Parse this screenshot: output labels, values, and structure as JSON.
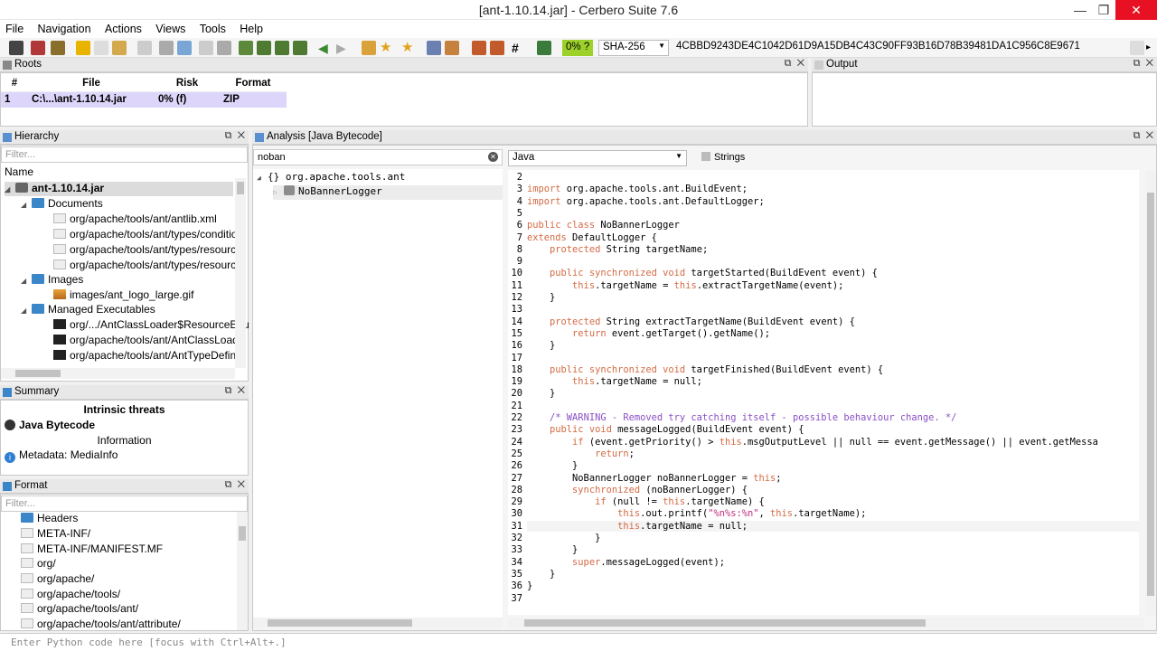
{
  "window": {
    "title": "[ant-1.10.14.jar] - Cerbero Suite 7.6"
  },
  "menu": [
    "File",
    "Navigation",
    "Actions",
    "Views",
    "Tools",
    "Help"
  ],
  "toolbar": {
    "progress": "0% ?",
    "hash_algo": "SHA-256",
    "hash_value": "4CBBD9243DE4C1042D61D9A15DB4C43C90FF93B16D78B39481DA1C956C8E9671"
  },
  "roots": {
    "title": "Roots",
    "columns": [
      "#",
      "File",
      "Risk",
      "Format"
    ],
    "rows": [
      {
        "num": "1",
        "file": "C:\\...\\ant-1.10.14.jar",
        "risk": "0% (f)",
        "format": "ZIP"
      }
    ]
  },
  "output": {
    "title": "Output"
  },
  "hierarchy": {
    "title": "Hierarchy",
    "filter_placeholder": "Filter...",
    "column": "Name",
    "items": [
      "ant-1.10.14.jar",
      "Documents",
      "org/apache/tools/ant/antlib.xml",
      "org/apache/tools/ant/types/conditio",
      "org/apache/tools/ant/types/resourc",
      "org/apache/tools/ant/types/resourc",
      "Images",
      "images/ant_logo_large.gif",
      "Managed Executables",
      "org/.../AntClassLoader$ResourceEnu",
      "org/apache/tools/ant/AntClassLoad",
      "org/apache/tools/ant/AntTypeDefin"
    ]
  },
  "summary": {
    "title": "Summary",
    "header": "Intrinsic threats",
    "threat": "Java Bytecode",
    "info_header": "Information",
    "info": "Metadata: MediaInfo"
  },
  "format": {
    "title": "Format",
    "filter_placeholder": "Filter...",
    "items": [
      "Headers",
      "META-INF/",
      "META-INF/MANIFEST.MF",
      "org/",
      "org/apache/",
      "org/apache/tools/",
      "org/apache/tools/ant/",
      "org/apache/tools/ant/attribute/"
    ]
  },
  "analysis": {
    "title": "Analysis [Java Bytecode]",
    "search_value": "noban",
    "language": "Java",
    "strings_label": "Strings",
    "tree_package": "org.apache.tools.ant",
    "tree_class": "NoBannerLogger",
    "package_glyph": "{}"
  },
  "code_lines": [
    {
      "n": "2",
      "html": ""
    },
    {
      "n": "3",
      "html": "<span class='kw'>import</span> org.apache.tools.ant.BuildEvent;"
    },
    {
      "n": "4",
      "html": "<span class='kw'>import</span> org.apache.tools.ant.DefaultLogger;"
    },
    {
      "n": "5",
      "html": ""
    },
    {
      "n": "6",
      "html": "<span class='kw'>public class</span> NoBannerLogger"
    },
    {
      "n": "7",
      "html": "<span class='kw'>extends</span> DefaultLogger {"
    },
    {
      "n": "8",
      "html": "    <span class='kw'>protected</span> String targetName;"
    },
    {
      "n": "9",
      "html": ""
    },
    {
      "n": "10",
      "html": "    <span class='kw'>public synchronized void</span> targetStarted(BuildEvent event) {"
    },
    {
      "n": "11",
      "html": "        <span class='kw'>this</span>.targetName = <span class='kw'>this</span>.extractTargetName(event);"
    },
    {
      "n": "12",
      "html": "    }"
    },
    {
      "n": "13",
      "html": ""
    },
    {
      "n": "14",
      "html": "    <span class='kw'>protected</span> String extractTargetName(BuildEvent event) {"
    },
    {
      "n": "15",
      "html": "        <span class='kw'>return</span> event.getTarget().getName();"
    },
    {
      "n": "16",
      "html": "    }"
    },
    {
      "n": "17",
      "html": ""
    },
    {
      "n": "18",
      "html": "    <span class='kw'>public synchronized void</span> targetFinished(BuildEvent event) {"
    },
    {
      "n": "19",
      "html": "        <span class='kw'>this</span>.targetName = null;"
    },
    {
      "n": "20",
      "html": "    }"
    },
    {
      "n": "21",
      "html": ""
    },
    {
      "n": "22",
      "html": "    <span class='cm'>/* WARNING - Removed try catching itself - possible behaviour change. */</span>"
    },
    {
      "n": "23",
      "html": "    <span class='kw'>public void</span> messageLogged(BuildEvent event) {"
    },
    {
      "n": "24",
      "html": "        <span class='kw'>if</span> (event.getPriority() &gt; <span class='kw'>this</span>.msgOutputLevel || null == event.getMessage() || event.getMessa"
    },
    {
      "n": "25",
      "html": "            <span class='kw'>return</span>;"
    },
    {
      "n": "26",
      "html": "        }"
    },
    {
      "n": "27",
      "html": "        NoBannerLogger noBannerLogger = <span class='kw'>this</span>;"
    },
    {
      "n": "28",
      "html": "        <span class='kw'>synchronized</span> (noBannerLogger) {"
    },
    {
      "n": "29",
      "html": "            <span class='kw'>if</span> (null != <span class='kw'>this</span>.targetName) {"
    },
    {
      "n": "30",
      "html": "                <span class='kw'>this</span>.out.printf(<span class='st'>\"%n%s:%n\"</span>, <span class='kw'>this</span>.targetName);"
    },
    {
      "n": "31",
      "html": "                <span class='kw'>this</span>.targetName = null;"
    },
    {
      "n": "32",
      "html": "            }"
    },
    {
      "n": "33",
      "html": "        }"
    },
    {
      "n": "34",
      "html": "        <span class='kw'>super</span>.messageLogged(event);"
    },
    {
      "n": "35",
      "html": "    }"
    },
    {
      "n": "36",
      "html": "}"
    },
    {
      "n": "37",
      "html": ""
    }
  ],
  "status": {
    "placeholder": "Enter Python code here [focus with Ctrl+Alt+.]"
  },
  "colors": {
    "keyword": "#d36b44",
    "comment": "#8a4fc5",
    "string": "#c0307f",
    "close_button": "#e81123"
  },
  "panel_buttons": {
    "float": "⧉",
    "close": "✕"
  }
}
